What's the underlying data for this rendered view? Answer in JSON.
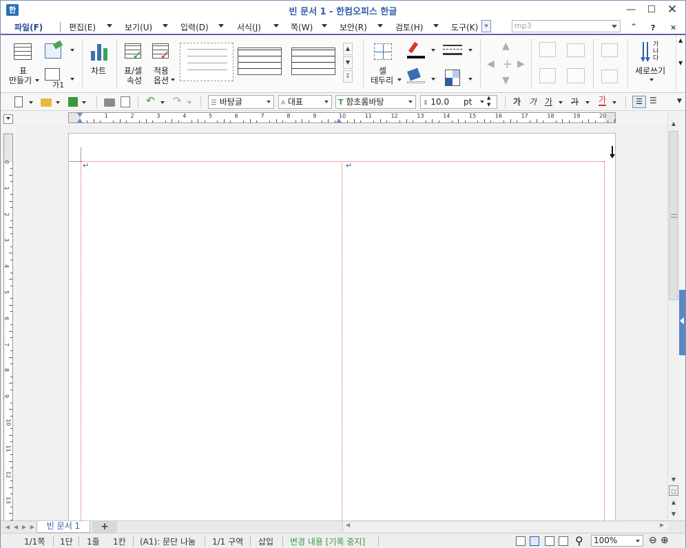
{
  "window": {
    "title": "빈 문서 1 - 한컴오피스 한글",
    "logo_glyph": "한"
  },
  "menu": {
    "items": [
      "파일(F)",
      "편집(E)",
      "보기(U)",
      "입력(D)",
      "서식(J)",
      "쪽(W)",
      "보안(R)",
      "검토(H)",
      "도구(K)"
    ],
    "search_value": "mp3"
  },
  "ribbon": {
    "make_table_label1": "표",
    "make_table_label2": "만들기",
    "chart_label": "차트",
    "table_props_label1": "표/셀",
    "table_props_label2": "속성",
    "apply_options_label1": "적용",
    "apply_options_label2": "옵션",
    "cell_border_label1": "셀",
    "cell_border_label2": "테두리",
    "vertical_write_label": "세로쓰기",
    "vertical_glyph": "가나다",
    "ga_label": "가1"
  },
  "toolbar": {
    "style": "바탕글",
    "lang": "대표",
    "font": "함초롬바탕",
    "font_size": "10.0",
    "size_unit": "pt",
    "bold_glyph": "가",
    "italic_glyph": "가",
    "underline_glyph": "가",
    "strike_glyph": "가",
    "color_glyph": "가"
  },
  "ruler": {
    "h_numbers": [
      "1",
      "2",
      "3",
      "4",
      "5",
      "6",
      "7",
      "8",
      "9",
      "10",
      "11",
      "12",
      "13",
      "14",
      "15",
      "16",
      "17",
      "18",
      "19",
      "20"
    ],
    "v_numbers": [
      "0",
      "1",
      "2",
      "3",
      "4",
      "5",
      "6",
      "7",
      "8",
      "9",
      "10",
      "11",
      "12",
      "13"
    ]
  },
  "tabs": {
    "doc_tab": "빈 문서 1",
    "add_tab": "+"
  },
  "status": {
    "page": "1/1쪽",
    "col": "1단",
    "line": "1줄",
    "char": "1칸",
    "section_mode": "(A1): 문단 나눔",
    "section": "1/1 구역",
    "insert_mode": "삽입",
    "track_changes": "변경 내용 [기록 중지]",
    "zoom": "100%"
  },
  "colors": {
    "accent": "#2e5da8",
    "margin_guide": "#e05050",
    "track_green": "#3a9a3a"
  }
}
